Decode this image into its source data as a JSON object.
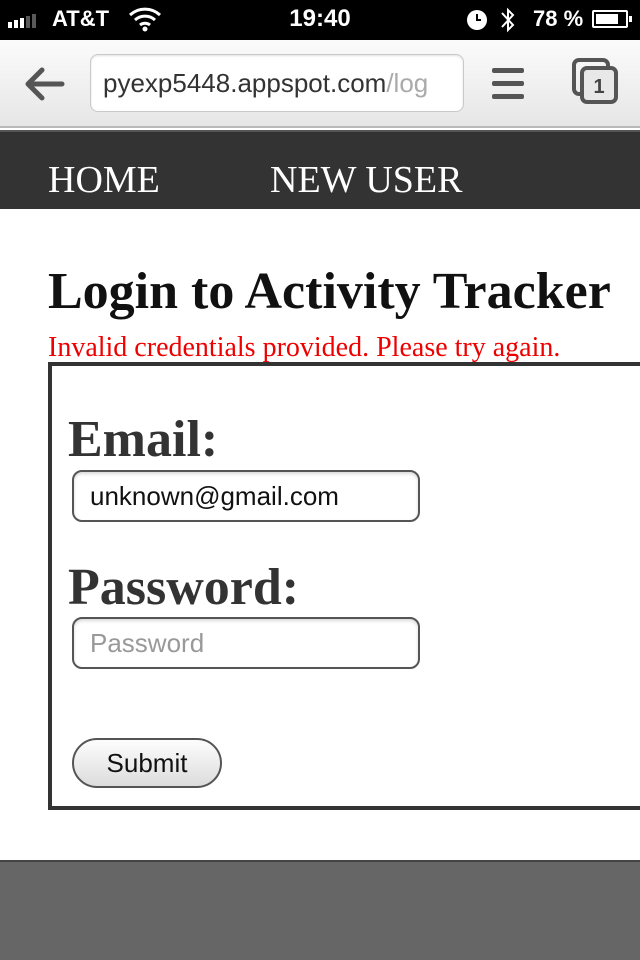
{
  "status_bar": {
    "carrier": "AT&T",
    "time": "19:40",
    "battery": "78 %",
    "battery_level": 0.78,
    "icons": [
      "signal-icon",
      "wifi-icon",
      "alarm-clock-icon",
      "bluetooth-icon",
      "battery-icon"
    ]
  },
  "browser": {
    "url_host": "pyexp5448.appspot.com",
    "url_path": "/log",
    "tab_count": "1",
    "icons": [
      "back-arrow-icon",
      "menu-icon",
      "tabs-icon"
    ]
  },
  "nav": {
    "home": "HOME",
    "new_user": "NEW USER"
  },
  "page": {
    "title": "Login to Activity Tracker",
    "error": "Invalid credentials provided. Please try again."
  },
  "form": {
    "email_label": "Email:",
    "email_value": "unknown@gmail.com",
    "password_label": "Password:",
    "password_placeholder": "Password",
    "submit_label": "Submit"
  },
  "colors": {
    "nav_bg": "#333333",
    "error": "#ee0000",
    "footer_bg": "#666666"
  }
}
